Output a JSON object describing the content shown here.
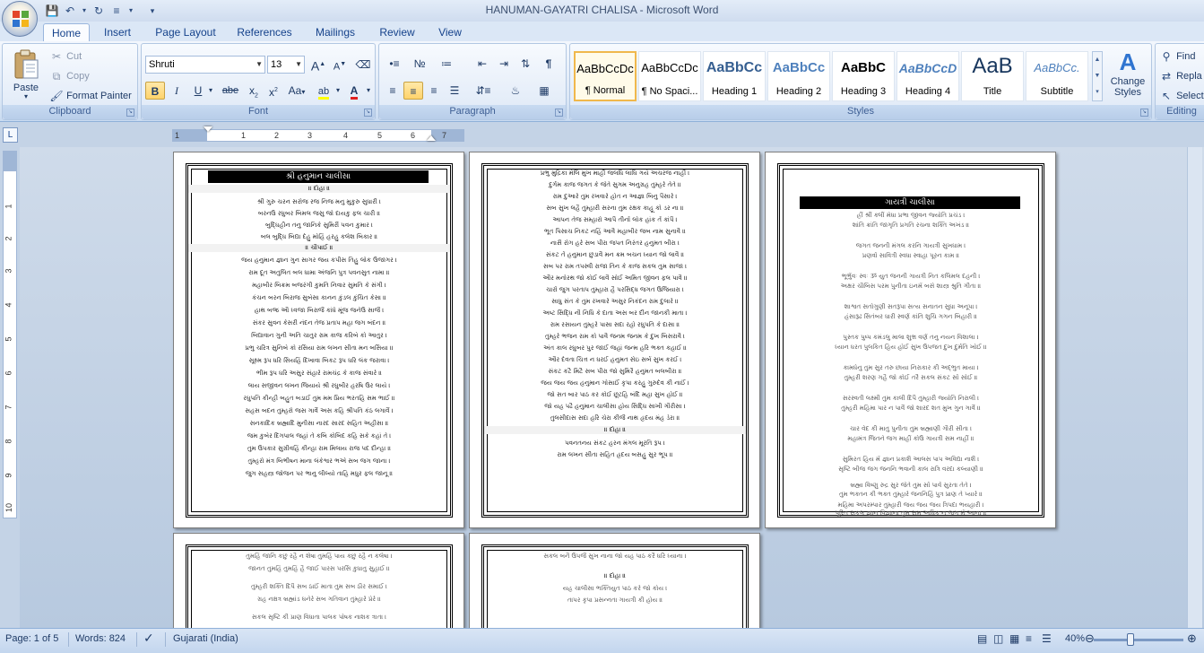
{
  "window": {
    "title": "HANUMAN-GAYATRI CHALISA - Microsoft Word"
  },
  "quick_access": [
    "save-icon",
    "undo-icon",
    "redo-icon",
    "bullets-icon",
    "customize-icon"
  ],
  "tabs": [
    {
      "label": "Home",
      "active": true
    },
    {
      "label": "Insert"
    },
    {
      "label": "Page Layout"
    },
    {
      "label": "References"
    },
    {
      "label": "Mailings"
    },
    {
      "label": "Review"
    },
    {
      "label": "View"
    }
  ],
  "clipboard": {
    "label": "Clipboard",
    "paste": "Paste",
    "cut": "Cut",
    "copy": "Copy",
    "format_painter": "Format Painter"
  },
  "font": {
    "label": "Font",
    "family": "Shruti",
    "size": "13",
    "grow": "A",
    "shrink": "A",
    "bold": "B",
    "italic": "I",
    "underline": "U",
    "strike": "abe",
    "subscript": "x",
    "superscript": "x",
    "change_case": "Aa",
    "font_color": "A"
  },
  "paragraph": {
    "label": "Paragraph",
    "show_marks": "¶"
  },
  "styles": {
    "label": "Styles",
    "items": [
      {
        "sample": "AaBbCcDc",
        "name": "¶ Normal",
        "selected": true
      },
      {
        "sample": "AaBbCcDc",
        "name": "¶ No Spaci..."
      },
      {
        "sample": "AaBbCc",
        "name": "Heading 1"
      },
      {
        "sample": "AaBbCc",
        "name": "Heading 2"
      },
      {
        "sample": "AaBbC",
        "name": "Heading 3"
      },
      {
        "sample": "AaBbCcD",
        "name": "Heading 4"
      },
      {
        "sample": "AaB",
        "name": "Title"
      },
      {
        "sample": "AaBbCc.",
        "name": "Subtitle"
      }
    ],
    "change_styles": "Change Styles"
  },
  "editing": {
    "label": "Editing",
    "find": "Find",
    "replace": "Repla",
    "select": "Select"
  },
  "ruler": {
    "numbers": [
      "1",
      "1",
      "2",
      "3",
      "4",
      "5",
      "6",
      "7"
    ]
  },
  "vruler": {
    "numbers": [
      "1",
      "2",
      "3",
      "4",
      "5",
      "6",
      "7",
      "8",
      "9",
      "10"
    ]
  },
  "document": {
    "page1": {
      "title": "શ્રી હનુમાન ચાલીસા",
      "doha_head": "॥ દોહા ॥",
      "doha": [
        "શ્રી ગુરુ ચરન સરોજ રજ નિજ મનુ મુકુરુ સુધારી ।",
        "બરનઉં રઘુબર બિમલ જસુ જો દાયકુ ફલ ચારી ॥",
        "બુદ્ધિહીન તનુ જાનિકે સુમિરૌં પવન કુમાર ।",
        "બલ બુદ્ધિ બિદ્યા દેહુ મોહિં હરહુ કલેશ બિકાર ॥"
      ],
      "chaupai_head": "॥ ચૌપાઈ ॥",
      "chaupai": [
        "જય હનુમાન જ્ઞાન ગુન સાગર જય કપીસ તિહુ લોક ઉજાગર ।",
        "રામ દૂત અતુલિત બલ ધામા અંજનિ પુત્ર પવનસુત નામા ॥",
        "મહાબીર બિક્રમ બજરંગી કુમતિ નિવાર સુમતિ કે સંગી ।",
        "કંચન બરન બિરાજ સુબેસા કાનન કુંડલ કુંચિત કેસા ॥",
        "હાથ બજ્ર ઔ ધ્વજા બિરાજૈ કાંધે મૂંજ જનેઉ સાજૈ ।",
        "સંકર સુવન કેસરી નંદન તેજ પ્રતાપ મહા જગ બંદન ॥",
        "બિદ્યાવાન ગુની અતિ ચાતુર રામ કાજ કરિબે કો આતુર ।",
        "પ્રભુ ચરિત્ર સુનિબે કો રસિયા રામ લખન સીતા મન બસિયા ॥",
        "સૂક્ષ્મ રૂપ ધરિ સિયહિં દિખાવા બિકટ રૂપ ધરિ લંક જરાવા ।",
        "ભીમ રૂપ ધરિ અસુર સંહારે રામચંદ્ર કે કાજ સંવારે ॥",
        "લાય સજીવન લખન જિયાયે શ્રી રઘુબીર હરષિ ઉર લાયે ।",
        "રઘુપતિ કીન્હી બહુત બડાઈ તુમ મમ પ્રિય ભરતહિ સમ ભાઈ ॥",
        "સહસ બદન તુમ્હરો જસ ગાવૈં અસ કહિ શ્રીપતિ કંઠ લગાવૈં ।",
        "સનકાદિક બ્રહ્માદિ મુનીસા નારદ સારદ સહિત અહીસા ॥",
        "જમ કુબેર દિગપાલ જહાં તે કબિ કોબિદ કહિ સકે કહાં તે ।",
        "તુમ ઉપકાર સુગ્રીવહિં કીન્હા રામ મિલાય રાજ પદ દીન્હા ॥",
        "તુમ્હરો મંત્ર બિભીષન માના લંકેશ્વર ભએ સબ જગ જાના ।",
        "જુગ સહસ્ત્ર જોજન પર ભાનુ લીલ્યો તાહિ મધુર ફલ જાનૂ ॥"
      ]
    },
    "page2": {
      "lines": [
        "પ્રભુ મુદ્રિકા મેલિ મુખ માહીં જલધિ લાંઘિ ગયે અચરજ નાહીં ।",
        "દુર્ગમ કાજ જગત કે જેતે સુગમ અનુગ્રહ તુમ્હરે તેતે ॥",
        "રામ દુઆરે તુમ રખવારે હોત ન આજ્ઞા બિનુ પૈસારે ।",
        "સબ સુખ લહૈ તુમ્હારી સરના તુમ રક્ષક કાહૂ કો ડર ના ॥",
        "આપન તેજ સમ્હારો આપૈ તીનોં લોક હાંક તેં કાંપૈ ।",
        "ભૂત પિસાચ નિકટ નહિં આવૈ મહાબીર જબ નામ સુનાવૈ ॥",
        "નાસૈ રોગ હરે સબ પીરા જપત નિરંતર હનુમત બીરા ।",
        "સંકટ તેં હનુમાન છુડાવૈ મન ક્રમ બચન ધ્યાન જો લાવૈ ॥",
        "સબ પર રામ તપસ્વી રાજા તિન કે કાજ સકલ તુમ સાજા ।",
        "ઔર મનોરથ જો કોઈ લાવૈ સોઈ અમિત જીવન ફલ પાવૈ ॥",
        "ચારોં જુગ પરતાપ તુમ્હારા હૈ પરસિદ્ધ જગત ઉજિયારા ।",
        "સાધુ સંત કે તુમ રખવારે અસુર નિકંદન રામ દુલારે ॥",
        "અષ્ટ સિદ્ધિ નૌ નિધિ કે દાતા અસ બર દીન જાનકી માતા ।",
        "રામ રસાયન તુમ્હરે પાસા સદા રહો રઘુપતિ કે દાસા ॥",
        "તુમ્હરે ભજન રામ કો પાવૈ જનમ જનમ કે દુખ બિસરાવૈ ।",
        "અંત કાલ રઘુબર પુર જાઈ જહાં જન્મ હરિ ભક્ત કહાઈ ॥",
        "ઔર દેવતા ચિત્ત ન ધરઈ હનુમત સેઇ સર્બ સુખ કરઈ ।",
        "સંકટ કટૈ મિટૈ સબ પીરા જો સુમિરૈ હનુમત બલબીરા ॥",
        "જય જય જય હનુમાન ગોસાઈં કૃપા કરહુ ગુરુદેવ કી નાઈં ।",
        "જો સત બાર પાઠ કર કોઈ છૂટહિ બંદિ મહા સુખ હોઈ ॥",
        "જો યહ પઢૈ હનુમાન ચાલીસા હોય સિદ્ધિ સાખી ગૌરીસા ।",
        "તુલસીદાસ સદા હરિ ચેરા કીજૈ નાથ હૃદય મંહ ડેરા ॥"
      ],
      "doha_head": "॥ દોહા ॥",
      "doha": [
        "પવનતનય સંકટ હરન મંગલ મૂરતિ રૂપ ।",
        "રામ લખન સીતા સહિત હૃદય બસહુ સુર ભૂપ ॥"
      ]
    },
    "page3": {
      "title": "ગાયત્રી ચાલીસા",
      "lines": [
        "હ્રીં શ્રીં ક્લીં મેધા પ્રભા જીવન જ્યોતિ પ્રચંડ ।",
        "શાંતિ ક્રાંતિ જાગૃતિ પ્રગતિ રચના શક્તિ અખંડ ॥",
        "જગત જનની મંગલ કરનિ ગાયત્રી સુખધામ ।",
        "પ્રણવોં સાવિત્રી સ્વધા સ્વાહા પૂરન કામ ॥",
        "ભૂર્ભુવઃ સ્વઃ ૐ યુત જનની ગાયત્રી નિત કલિમલ દહની ।",
        "અક્ષર ચૌબિસ પરમ પુનીતા ઇનમેં બસે શાસ્ત્ર શ્રુતિ ગીતા ॥",
        "શાશ્વત સતોગુણી સતરૂપા સત્ય સનાતન સુધા અનૂપા ।",
        "હંસારૂઢ સિતંબર ધારી સ્વર્ણ કાંતિ શુચિ ગગન બિહારી ॥",
        "પુસ્તક પુષ્પ કમંડલુ માલા શુભ્ર વર્ણ તનુ નયન વિશાલા ।",
        "ધ્યાન ધરત પુલકિત હિય હોઈ સુખ ઉપજત દુખ દુર્મતિ ખોઈ ॥",
        "કામધેનુ તુમ સુર તરુ છાયા નિરાકાર કી અદ્ભુત માયા ।",
        "તુમ્હરી શરણ ગહૈ જો કોઈ તરૈ સકલ સંકટ સોં સોઈ ॥",
        "સરસ્વતી લક્ષ્મી તુમ કાલી દિપૈ તુમ્હારી જ્યોતિ નિરાલી ।",
        "તુમ્હરી મહિમા પાર ન પાવૈં જો શારદ શત મુખ ગુન ગાવૈં ॥",
        "ચાર વેદ કી માતુ પુનીતા તુમ બ્રહ્માણી ગૌરી સીતા ।",
        "મહામંત્ર જિતને જગ માહીં કોઉ ગાયત્રી સમ નાહીં ॥",
        "સુમિરત હિય મેં જ્ઞાન પ્રકાશૈ આલસ પાપ અવિદ્યા નાશૈ ।",
        "સૃષ્ટિ બીજ જગ જનનિ ભવાની કાલ રાત્રિ વરદા કલ્યાણી ॥",
        "બ્રહ્મા વિષ્ણુ રુદ્ર સુર જેતે તુમ સોં પાવેં સુરતા તેતે ।",
        "તુમ ભક્તન કી ભક્ત તુમ્હારે જનનિહિં પુત્ર પ્રાણ તે પ્યારે ॥",
        "મહિમા અપરમ્પાર તુમ્હારી જય જય જય ત્રિપદા ભયહારી ।",
        "પૂરિત સકલ જ્ઞાન વિજ્ઞાના તુમ સમ અધિક ન જગ મેં આના ॥"
      ]
    },
    "page4": {
      "lines": [
        "તુમહિં જાનિ કછુ રહૈ ન શેષા તુમહિં પાય કછુ રહૈ ન કલેષા ।",
        "જાનત તુમહિં તુમહિં હૈ જાઈ પારસ પરસિ કુધાતુ સુહાઈ ॥",
        "તુમ્હરી શક્તિ દિપૈ સબ ઠાઈં માતા તુમ સબ ઠૌર સમાઈ ।",
        "ગ્રહ નક્ષત્ર બ્રહ્માંડ ઘનેરે સબ ગતિવાન તુમ્હારે પ્રેરે ॥",
        "સકલ સૃષ્ટિ કી પ્રાણ વિધાતા પાલક પોષક નાશક ત્રાતા ।"
      ]
    },
    "page5": {
      "lines": [
        "સકલ બનૈ ઉપજૈ સુખ નાના જો યહ પાઠ કરૈ ધરિ ધ્યાના ।",
        "",
        "॥ દોહા ॥",
        "યહ ચાલીસા ભક્તિયુત પાઠ કરે જો કોય ।",
        "તાપર કૃપા પ્રસન્નતા ગાયત્રી કી હોય ॥"
      ]
    }
  },
  "status": {
    "page": "Page: 1 of 5",
    "words": "Words: 824",
    "language": "Gujarati (India)",
    "zoom": "40%",
    "zoom_level": 0.4
  }
}
